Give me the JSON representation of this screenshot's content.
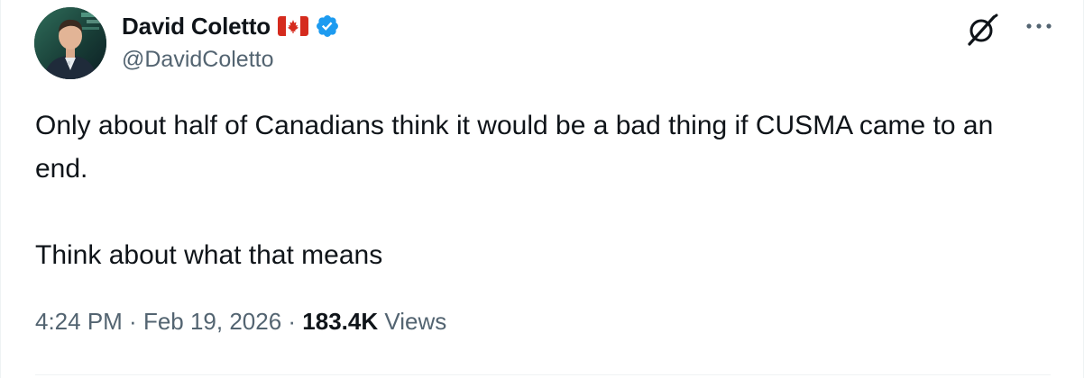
{
  "author": {
    "display_name": "David Coletto",
    "handle": "@DavidColetto",
    "flag_icon": "canada-flag-icon",
    "verified_icon": "verified-badge-icon",
    "verified_color": "#1d9bf0"
  },
  "actions": {
    "grok_icon": "grok-icon",
    "more_icon": "more-options-icon"
  },
  "tweet": {
    "line1": "Only about half of Canadians think it would be a bad thing if CUSMA came to an end.",
    "line2": "Think about what that means"
  },
  "meta": {
    "time": "4:24 PM",
    "separator1": " · ",
    "date": "Feb 19, 2026",
    "separator2": " · ",
    "views_count": "183.4K",
    "views_label": " Views"
  },
  "colors": {
    "text_primary": "#0f1419",
    "text_secondary": "#536471",
    "flag_red": "#d52b1e"
  }
}
